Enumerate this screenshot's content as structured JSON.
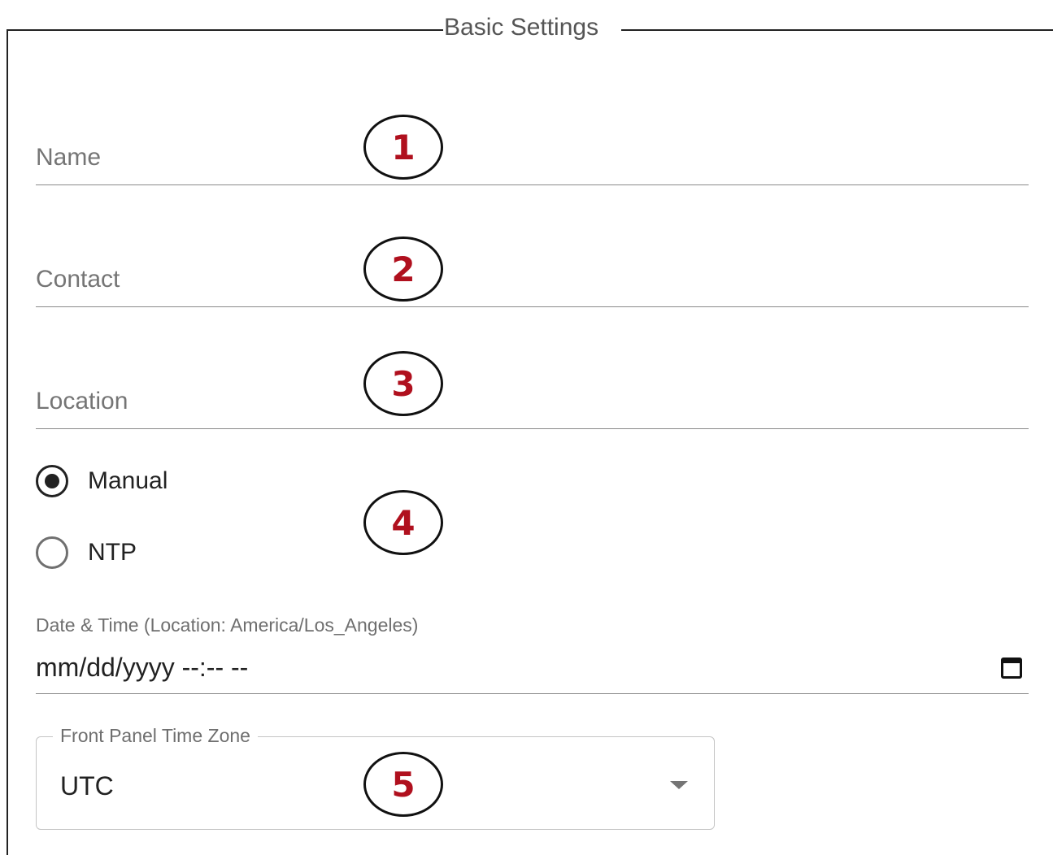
{
  "section": {
    "title": "Basic Settings"
  },
  "fields": {
    "name_label": "Name",
    "contact_label": "Contact",
    "location_label": "Location"
  },
  "time_source": {
    "options": [
      {
        "label": "Manual",
        "selected": true
      },
      {
        "label": "NTP",
        "selected": false
      }
    ]
  },
  "datetime": {
    "caption": "Date & Time (Location: America/Los_Angeles)",
    "value": "mm/dd/yyyy --:-- --",
    "icon": "calendar-icon"
  },
  "timezone": {
    "legend": "Front Panel Time Zone",
    "value": "UTC",
    "icon": "dropdown-arrow-icon"
  },
  "callouts": [
    "1",
    "2",
    "3",
    "4",
    "5"
  ],
  "colors": {
    "callout_number": "#b0101e",
    "radio_checked": "#222222"
  }
}
